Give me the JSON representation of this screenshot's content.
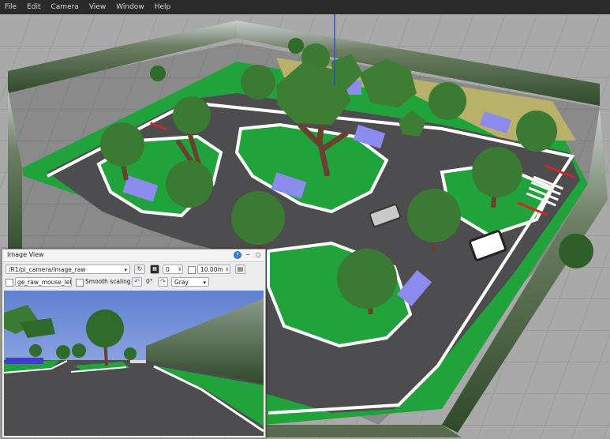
{
  "menubar": {
    "items": [
      {
        "id": "file",
        "label": "File"
      },
      {
        "id": "edit",
        "label": "Edit"
      },
      {
        "id": "camera",
        "label": "Camera"
      },
      {
        "id": "view",
        "label": "View"
      },
      {
        "id": "window",
        "label": "Window"
      },
      {
        "id": "help",
        "label": "Help"
      }
    ]
  },
  "image_view": {
    "title": "Image View",
    "topic": "/R1/pi_camera/image_raw",
    "min_value": "0",
    "max_value": "10.00m",
    "mouse_topic": "ge_raw_mouse_left",
    "smooth_scaling_label": "Smooth scaling",
    "smooth_scaling_checked": false,
    "rotation": "0°",
    "color_scheme": "Gray",
    "icons": {
      "window_icon": "image-view-icon",
      "help": "help-icon",
      "close": "close-icon",
      "refresh": "refresh-icon",
      "save": "save-icon",
      "rotate_left": "rotate-left-icon",
      "rotate_right": "rotate-right-icon"
    }
  },
  "colors": {
    "grass": "#1fa33a",
    "road": "#4d4d4f",
    "lane_white": "#ffffff",
    "sky": "#6f8fd8",
    "menubar_bg": "#2b2b2b",
    "window_bg": "#ececec"
  }
}
